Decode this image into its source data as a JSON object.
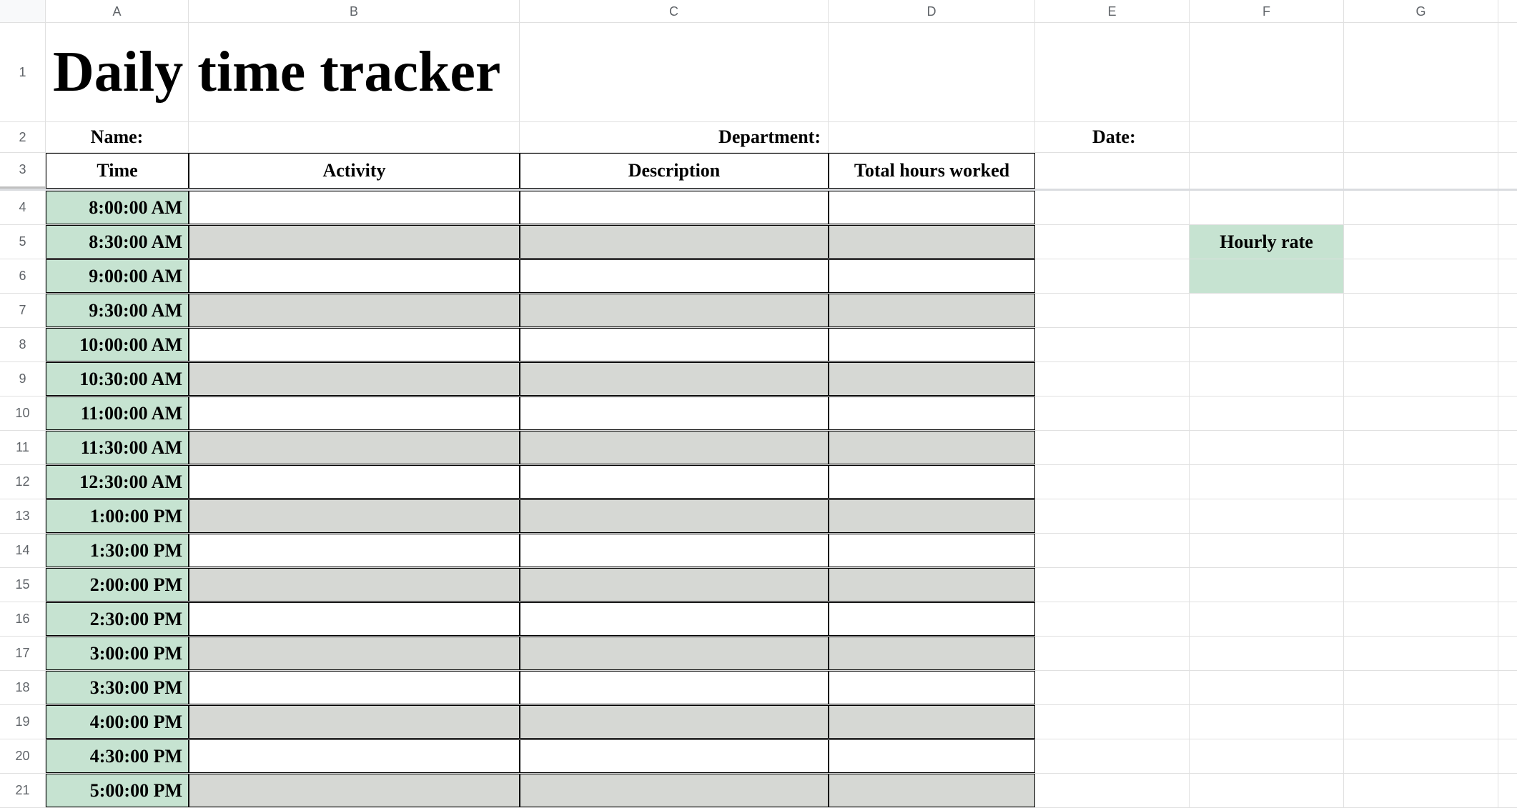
{
  "columns": [
    "A",
    "B",
    "C",
    "D",
    "E",
    "F",
    "G"
  ],
  "rows": [
    "1",
    "2",
    "3",
    "4",
    "5",
    "6",
    "7",
    "8",
    "9",
    "10",
    "11",
    "12",
    "13",
    "14",
    "15",
    "16",
    "17",
    "18",
    "19",
    "20",
    "21"
  ],
  "title": "Daily time tracker",
  "labels": {
    "name": "Name:",
    "department": "Department:",
    "date": "Date:"
  },
  "table_headers": {
    "time": "Time",
    "activity": "Activity",
    "description": "Description",
    "total_hours": "Total hours worked"
  },
  "hourly_rate_label": "Hourly rate",
  "times": [
    "8:00:00 AM",
    "8:30:00 AM",
    "9:00:00 AM",
    "9:30:00 AM",
    "10:00:00 AM",
    "10:30:00 AM",
    "11:00:00 AM",
    "11:30:00 AM",
    "12:30:00 AM",
    "1:00:00 PM",
    "1:30:00 PM",
    "2:00:00 PM",
    "2:30:00 PM",
    "3:00:00 PM",
    "3:30:00 PM",
    "4:00:00 PM",
    "4:30:00 PM",
    "5:00:00 PM"
  ]
}
